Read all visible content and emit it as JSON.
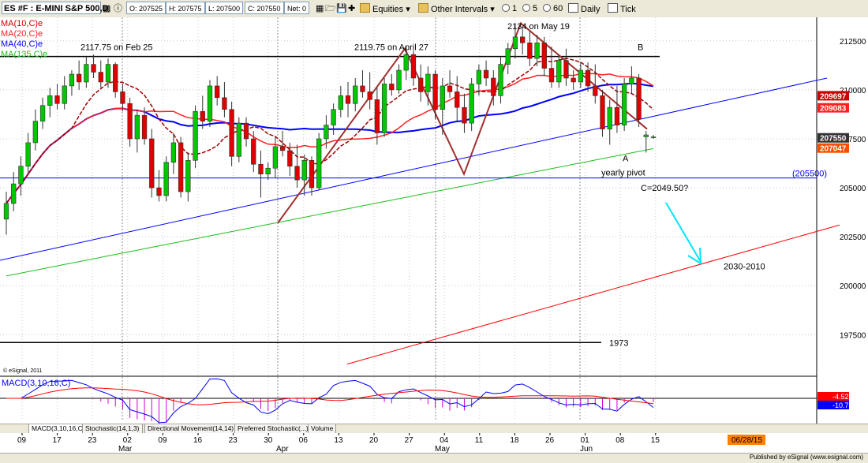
{
  "toolbar": {
    "symbol": "ES #F : E-MINI S&P 500,D",
    "ohlc": [
      "O: 207525",
      "H: 207575",
      "L: 207500",
      "C: 207550",
      "Net: 0"
    ],
    "equities_label": "Equities",
    "intervals_label": "Other Intervals",
    "intervals": [
      "1",
      "5",
      "60"
    ],
    "daily_label": "Daily",
    "tick_label": "Tick"
  },
  "legend": [
    {
      "label": "MA(10,C)e",
      "color": "#cc0000"
    },
    {
      "label": "MA(20,C)e",
      "color": "#ff2020"
    },
    {
      "label": "MA(40,C)e",
      "color": "#0000ff"
    },
    {
      "label": "MA(135,C)e",
      "color": "#1fbf1f"
    }
  ],
  "copyright": "© eSignal, 2011",
  "macd": {
    "label": "MACD(3,10,16,C)",
    "value1": "-4.52",
    "value2": "-10.78"
  },
  "tabs": [
    "MACD(3,10,16,C)",
    "Stochastic(14,1,3)",
    "Directional Movement(14,14)",
    "Preferred Stochastic(...)",
    "Volume"
  ],
  "xaxis": {
    "days": [
      "09",
      "17",
      "23",
      "02",
      "09",
      "16",
      "23",
      "30",
      "06",
      "13",
      "20",
      "27",
      "04",
      "11",
      "18",
      "26",
      "01",
      "08",
      "15"
    ],
    "months": [
      "Mar",
      "Apr",
      "May",
      "Jun"
    ],
    "date_box": "06/28/15"
  },
  "status_text": "Published by eSignal (www.esignal.com)",
  "chart_data": {
    "type": "candlestick",
    "title": "",
    "y_scale_display": "price x 100",
    "ylim": [
      1955,
      2137
    ],
    "y_ticks": [
      "212500",
      "210000",
      "207500",
      "205000",
      "202500",
      "200000",
      "197500"
    ],
    "price_labels": [
      {
        "text": "209697",
        "value": 2096.97,
        "color": "#cc0000"
      },
      {
        "text": "209083",
        "value": 2090.83,
        "color": "#ff2020"
      },
      {
        "text": "207550",
        "value": 2075.5,
        "color": "#333333"
      },
      {
        "text": "207047",
        "value": 2070.47,
        "color": "#ff4d00"
      }
    ],
    "yearly_pivot": {
      "value": 2055.0,
      "text": "(205500)",
      "label": "yearly pivot"
    },
    "annotations": [
      {
        "text": "2117.75 on Feb 25"
      },
      {
        "text": "2119.75 on April 27"
      },
      {
        "text": "2134 on May 19"
      },
      {
        "text": "B"
      },
      {
        "text": "A"
      },
      {
        "text": "C=2049.50?"
      },
      {
        "text": "2030-2010"
      },
      {
        "text": "1973"
      }
    ],
    "candles": [
      [
        2034,
        2048,
        2026,
        2042
      ],
      [
        2042,
        2058,
        2038,
        2052
      ],
      [
        2052,
        2066,
        2046,
        2061
      ],
      [
        2061,
        2078,
        2057,
        2073
      ],
      [
        2073,
        2090,
        2069,
        2084
      ],
      [
        2084,
        2096,
        2080,
        2092
      ],
      [
        2092,
        2101,
        2086,
        2097
      ],
      [
        2097,
        2103,
        2090,
        2093
      ],
      [
        2093,
        2107,
        2090,
        2102
      ],
      [
        2102,
        2110,
        2097,
        2108
      ],
      [
        2108,
        2115,
        2100,
        2104
      ],
      [
        2104,
        2117,
        2101,
        2113
      ],
      [
        2113,
        2118,
        2106,
        2109
      ],
      [
        2109,
        2115,
        2101,
        2104
      ],
      [
        2104,
        2116,
        2101,
        2113
      ],
      [
        2113,
        2114,
        2096,
        2099
      ],
      [
        2099,
        2103,
        2089,
        2093
      ],
      [
        2093,
        2096,
        2071,
        2075
      ],
      [
        2075,
        2090,
        2068,
        2087
      ],
      [
        2087,
        2091,
        2072,
        2075
      ],
      [
        2075,
        2080,
        2045,
        2050
      ],
      [
        2050,
        2059,
        2043,
        2046
      ],
      [
        2046,
        2066,
        2043,
        2063
      ],
      [
        2063,
        2078,
        2057,
        2073
      ],
      [
        2073,
        2076,
        2045,
        2048
      ],
      [
        2048,
        2068,
        2043,
        2064
      ],
      [
        2064,
        2092,
        2060,
        2089
      ],
      [
        2089,
        2097,
        2080,
        2084
      ],
      [
        2084,
        2105,
        2081,
        2102
      ],
      [
        2102,
        2107,
        2092,
        2096
      ],
      [
        2096,
        2104,
        2086,
        2090
      ],
      [
        2090,
        2094,
        2061,
        2066
      ],
      [
        2066,
        2086,
        2063,
        2083
      ],
      [
        2083,
        2086,
        2071,
        2075
      ],
      [
        2075,
        2079,
        2058,
        2062
      ],
      [
        2062,
        2069,
        2045,
        2057
      ],
      [
        2057,
        2063,
        2054,
        2060
      ],
      [
        2060,
        2076,
        2055,
        2071
      ],
      [
        2071,
        2079,
        2066,
        2069
      ],
      [
        2069,
        2073,
        2056,
        2061
      ],
      [
        2061,
        2072,
        2050,
        2054
      ],
      [
        2054,
        2067,
        2046,
        2064
      ],
      [
        2064,
        2066,
        2046,
        2050
      ],
      [
        2050,
        2078,
        2049,
        2075
      ],
      [
        2075,
        2087,
        2070,
        2082
      ],
      [
        2082,
        2093,
        2077,
        2090
      ],
      [
        2090,
        2102,
        2086,
        2097
      ],
      [
        2097,
        2104,
        2086,
        2093
      ],
      [
        2093,
        2106,
        2089,
        2102
      ],
      [
        2102,
        2110,
        2096,
        2099
      ],
      [
        2099,
        2109,
        2090,
        2095
      ],
      [
        2095,
        2101,
        2072,
        2078
      ],
      [
        2078,
        2106,
        2076,
        2103
      ],
      [
        2103,
        2108,
        2097,
        2100
      ],
      [
        2100,
        2113,
        2098,
        2110
      ],
      [
        2110,
        2122,
        2105,
        2118
      ],
      [
        2118,
        2120,
        2102,
        2106
      ],
      [
        2106,
        2113,
        2094,
        2099
      ],
      [
        2099,
        2112,
        2092,
        2108
      ],
      [
        2108,
        2110,
        2085,
        2090
      ],
      [
        2090,
        2106,
        2077,
        2102
      ],
      [
        2102,
        2110,
        2096,
        2099
      ],
      [
        2099,
        2107,
        2084,
        2091
      ],
      [
        2091,
        2098,
        2078,
        2083
      ],
      [
        2083,
        2106,
        2079,
        2103
      ],
      [
        2103,
        2113,
        2097,
        2110
      ],
      [
        2110,
        2115,
        2102,
        2106
      ],
      [
        2106,
        2110,
        2092,
        2097
      ],
      [
        2097,
        2117,
        2093,
        2113
      ],
      [
        2113,
        2124,
        2108,
        2121
      ],
      [
        2121,
        2134,
        2116,
        2127
      ],
      [
        2127,
        2132,
        2118,
        2124
      ],
      [
        2124,
        2130,
        2112,
        2116
      ],
      [
        2116,
        2128,
        2112,
        2124
      ],
      [
        2124,
        2127,
        2107,
        2111
      ],
      [
        2111,
        2122,
        2101,
        2104
      ],
      [
        2104,
        2118,
        2101,
        2115
      ],
      [
        2115,
        2121,
        2102,
        2106
      ],
      [
        2106,
        2110,
        2100,
        2104
      ],
      [
        2104,
        2114,
        2101,
        2110
      ],
      [
        2110,
        2114,
        2099,
        2102
      ],
      [
        2102,
        2113,
        2093,
        2097
      ],
      [
        2097,
        2100,
        2076,
        2080
      ],
      [
        2080,
        2095,
        2072,
        2091
      ],
      [
        2091,
        2102,
        2078,
        2082
      ],
      [
        2082,
        2106,
        2079,
        2103
      ],
      [
        2103,
        2112,
        2098,
        2106
      ],
      [
        2106,
        2108,
        2081,
        2085
      ],
      [
        2076,
        2079,
        2068,
        2077
      ],
      [
        2076,
        2077,
        2075,
        2076
      ]
    ]
  }
}
